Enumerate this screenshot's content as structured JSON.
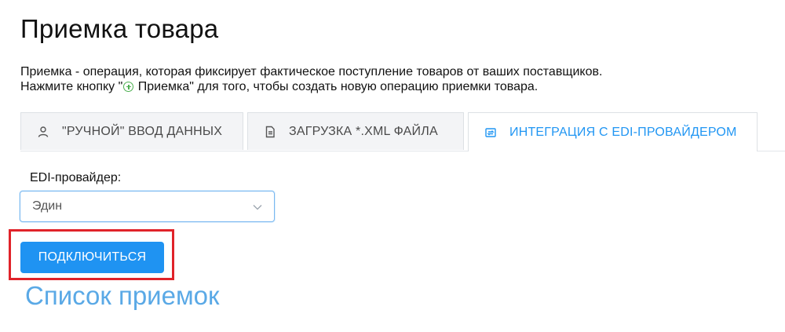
{
  "page": {
    "title": "Приемка товара"
  },
  "intro": {
    "line1": "Приемка - операция, которая фиксирует фактическое поступление товаров от ваших поставщиков.",
    "line2_before": "Нажмите кнопку \"",
    "line2_button_name": " Приемка",
    "line2_after": "\" для того, чтобы создать новую операцию приемки товара.",
    "plus_icon": "plus-circle-icon",
    "plus_color": "#4caf50"
  },
  "tabs": [
    {
      "label": "\"РУЧНОЙ\" ВВОД ДАННЫХ",
      "icon": "user-icon",
      "active": false
    },
    {
      "label": "ЗАГРУЗКА *.XML ФАЙЛА",
      "icon": "document-icon",
      "active": false
    },
    {
      "label": "ИНТЕГРАЦИЯ С EDI-ПРОВАЙДЕРОМ",
      "icon": "sync-icon",
      "active": true
    }
  ],
  "form": {
    "provider_label": "EDI-провайдер:",
    "provider_value": "Эдин",
    "connect_label": "ПОДКЛЮЧИТЬСЯ"
  },
  "links": {
    "receipts_list": "Список приемок"
  },
  "colors": {
    "accent": "#2196f3",
    "button": "#1f93f2",
    "link": "#5aa9e6",
    "highlight": "#e0232a"
  }
}
